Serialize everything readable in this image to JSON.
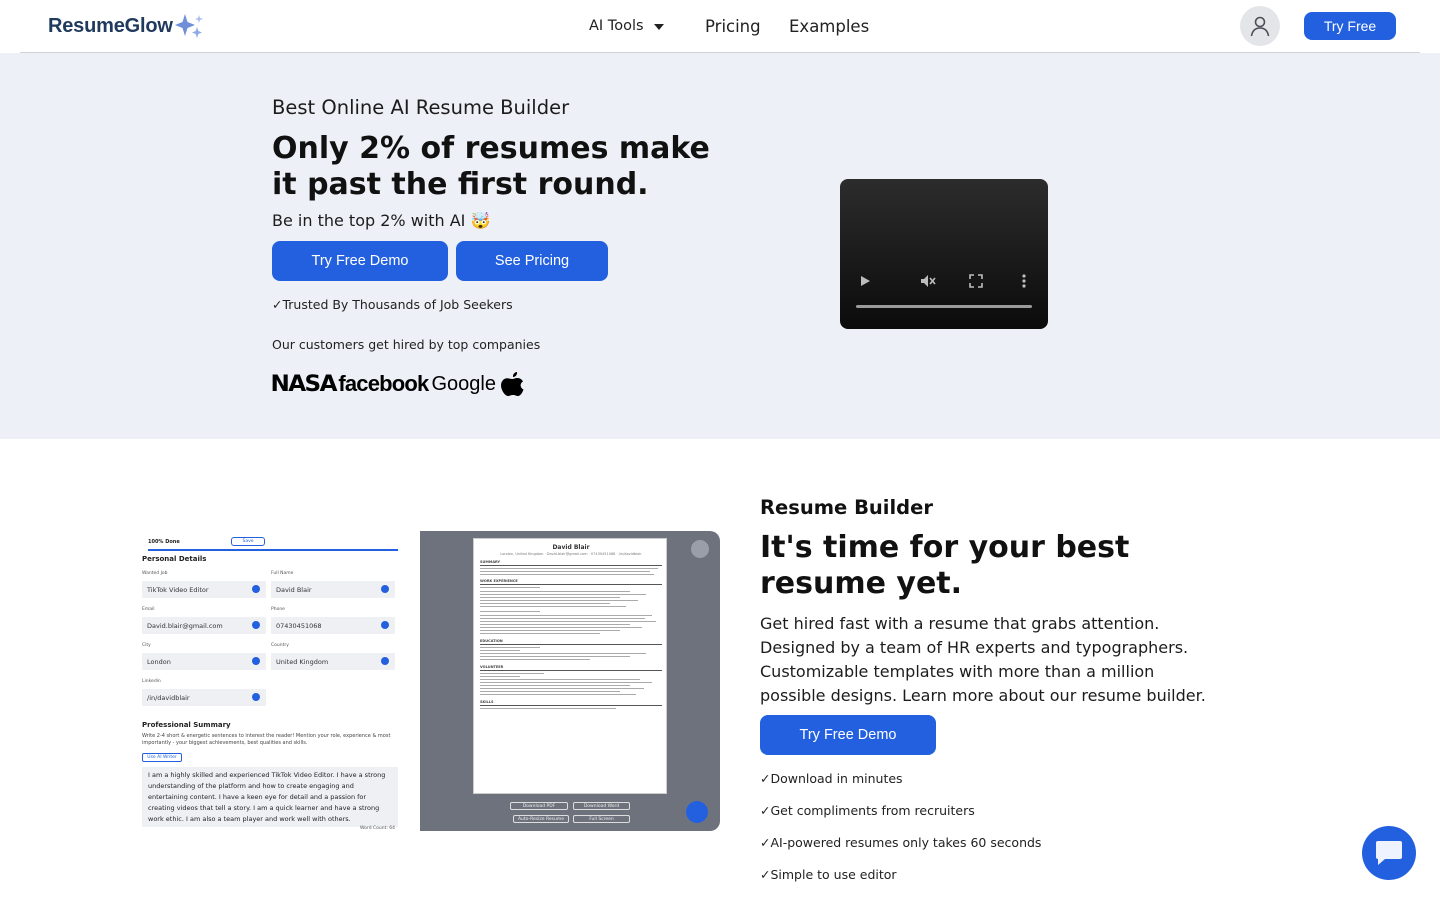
{
  "header": {
    "logo_text": "ResumeGlow",
    "nav": {
      "ai_tools": "AI Tools",
      "pricing": "Pricing",
      "examples": "Examples"
    },
    "try_free": "Try Free"
  },
  "hero": {
    "eyebrow": "Best Online AI Resume Builder",
    "title": "Only 2% of resumes make it past the first round.",
    "subtitle": "Be in the top 2% with AI 🤯",
    "demo_button": "Try Free Demo",
    "pricing_button": "See Pricing",
    "trusted": "✓Trusted By Thousands of Job Seekers",
    "customers": "Our customers get hired by top companies",
    "brands": [
      "NASA",
      "facebook",
      "Google"
    ]
  },
  "preview": {
    "done_label": "100% Done",
    "save_label": "Save",
    "personal_details": "Personal Details",
    "fields": [
      {
        "label": "Wanted Job",
        "value": "TikTok Video Editor"
      },
      {
        "label": "Full Name",
        "value": "David Blair"
      },
      {
        "label": "Email",
        "value": "David.blair@gmail.com"
      },
      {
        "label": "Phone",
        "value": "07430451068"
      },
      {
        "label": "City",
        "value": "London"
      },
      {
        "label": "Country",
        "value": "United Kingdom"
      },
      {
        "label": "Linkedin",
        "value": "/in/davidblair"
      }
    ],
    "summary_heading": "Professional Summary",
    "summary_hint": "Write 2-4 short & energetic sentences to interest the reader! Mention your role, experience & most importantly - your biggest achievements, best qualities and skills.",
    "ai_writer": "Use AI Writer",
    "summary_text": "I am a highly skilled and experienced TikTok Video Editor. I have a strong understanding of the platform and how to create engaging and entertaining content. I have a keen eye for detail and a passion for creating videos that tell a story. I am a quick learner and have a strong work ethic. I am also a team player and work well with others.",
    "word_count": "Word Count: 64",
    "resume_name": "David Blair",
    "resume_contact": "London, United Kingdom · David.blair@gmail.com · 07430451068 · /in/davidblair",
    "sections": [
      "SUMMARY",
      "WORK EXPERIENCE",
      "EDUCATION",
      "VOLUNTEER",
      "SKILLS"
    ],
    "buttons": [
      "Download PDF",
      "Download Word",
      "Auto-Resize Resume",
      "Full Screen"
    ]
  },
  "builder": {
    "eyebrow": "Resume Builder",
    "title": "It's time for your best resume yet.",
    "body": "Get hired fast with a resume that grabs attention. Designed by a team of HR experts and typographers. Customizable templates with more than a million possible designs. Learn more about our resume builder.",
    "demo_button": "Try Free Demo",
    "features": [
      "✓Download in minutes",
      "✓Get compliments from recruiters",
      "✓AI-powered resumes only takes 60 seconds",
      "✓Simple to use editor"
    ]
  },
  "colors": {
    "accent": "#2360e0",
    "hero_bg": "#edf0f6",
    "logo": "#1f3a5c"
  },
  "icons": [
    "sparkle-icon",
    "chevron-down-icon",
    "user-icon",
    "play-icon",
    "mute-icon",
    "fullscreen-icon",
    "more-vertical-icon",
    "apple-logo-icon",
    "check-icon",
    "chat-icon"
  ]
}
